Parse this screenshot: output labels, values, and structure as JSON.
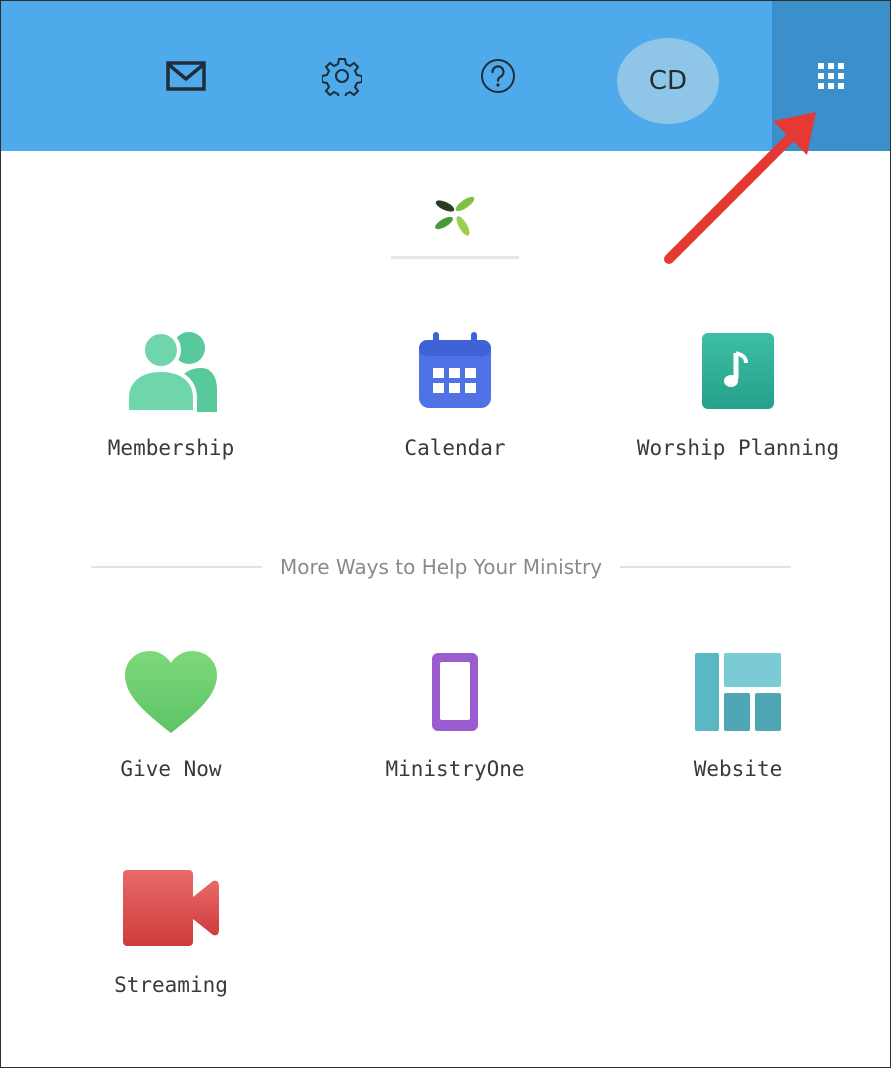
{
  "topbar": {
    "background_color": "#4eaaeb",
    "icons": {
      "mail": "mail-icon",
      "settings": "gear-icon",
      "help": "help-icon",
      "apps": "apps-grid-icon"
    },
    "avatar_initials": "CD"
  },
  "logo": {
    "icon": "leaf-logo-icon"
  },
  "apps": [
    {
      "label": "Membership",
      "icon": "people-icon",
      "color": "#57c99a"
    },
    {
      "label": "Calendar",
      "icon": "calendar-icon",
      "color": "#4f73e6"
    },
    {
      "label": "Worship Planning",
      "icon": "music-note-icon",
      "color": "#2fae99"
    }
  ],
  "section_divider": {
    "text": "More Ways to Help Your Ministry"
  },
  "more_apps": [
    {
      "label": "Give Now",
      "icon": "heart-icon",
      "color": "#68cc6b"
    },
    {
      "label": "MinistryOne",
      "icon": "phone-icon",
      "color": "#9b5ccf"
    },
    {
      "label": "Website",
      "icon": "website-layout-icon",
      "color": "#5bb7c4"
    },
    {
      "label": "Streaming",
      "icon": "video-camera-icon",
      "color": "#d94848"
    }
  ],
  "annotation": {
    "icon": "red-arrow-icon",
    "color": "#e53935"
  }
}
